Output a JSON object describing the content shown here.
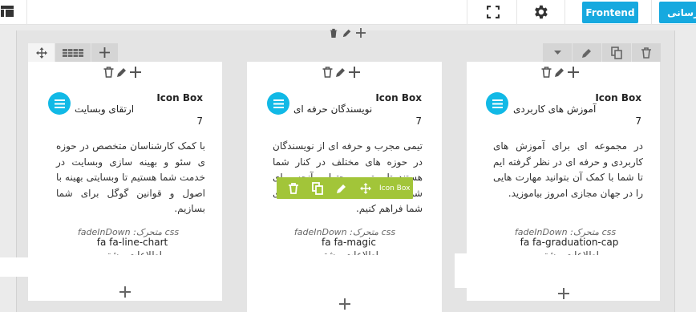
{
  "toolbar": {
    "frontend_label": "Frontend",
    "site_label": "رسانی"
  },
  "columns": [
    {
      "title": "Icon Box",
      "subtitle": "آموزش های کاربردی",
      "num": "7",
      "body": "در مجموعه ای برای آموزش های کاربردی و حرفه ای در نظر گرفته ایم تا شما با کمک آن بتوانید مهارت هایی را در جهان مجازی امروز بیاموزید.",
      "meta": "css متحرک: fadeInDown",
      "cls": "fa fa-graduation-cap",
      "more": "اطلاعات بیشتر"
    },
    {
      "title": "Icon Box",
      "subtitle": "نویسندگان حرفه ای",
      "num": "7",
      "body": "تیمی مجرب و حرفه ای از نویسندگان در حوزه های مختلف در کنار شما هستند تا بهترین محتوا و آنچه برای شما مفید است را با کیفیت را برای شما فراهم کنیم.",
      "meta": "css متحرک: fadeInDown",
      "cls": "fa fa-magic",
      "more": "اطلاعات بیشتر"
    },
    {
      "title": "Icon Box",
      "subtitle": "ارتقای وبسایت",
      "num": "7",
      "body": "با کمک کارشناسان متخصص در حوزه ی سئو و بهینه سازی وبسایت در خدمت شما هستیم تا وبسایتی بهینه با اصول و قوانین گوگل برای شما بسازیم.",
      "meta": "css متحرک: fadeInDown",
      "cls": "fa fa-line-chart",
      "more": "اطلاعات بیشتر"
    }
  ],
  "element_bar": {
    "label": "Icon Box"
  },
  "colors": {
    "accent": "#16a9df",
    "icon_circle": "#11b9e6",
    "element_bar": "#a2c539"
  },
  "icons": {
    "logo": "layout-icon",
    "fullscreen": "fullscreen-icon",
    "settings": "gear-icon",
    "move": "move-icon",
    "layout": "row-layout-icon",
    "add": "plus-icon",
    "dropdown": "caret-down-icon",
    "edit": "pencil-icon",
    "clone": "clone-icon",
    "delete": "trash-icon",
    "iconbox": "list-icon"
  }
}
